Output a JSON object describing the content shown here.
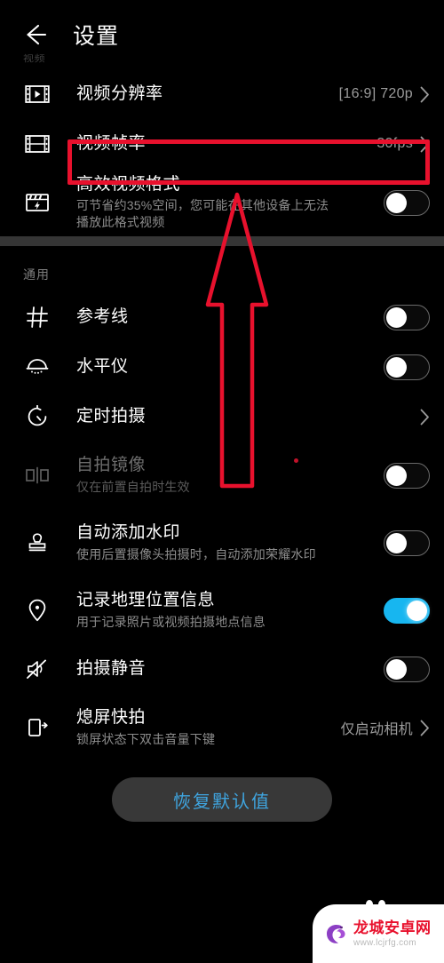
{
  "header": {
    "back_icon": "back-arrow-icon",
    "title": "设置",
    "faint_caption": "视频"
  },
  "video_section": {
    "rows": [
      {
        "icon": "video-resolution-icon",
        "title": "视频分辨率",
        "value": "[16:9] 720p",
        "control": "chevron"
      },
      {
        "icon": "video-framerate-icon",
        "title": "视频帧率",
        "value": "30fps",
        "control": "chevron",
        "highlighted": true
      },
      {
        "icon": "efficient-video-format-icon",
        "title": "高效视频格式",
        "subtitle": "可节省约35%空间，您可能在其他设备上无法播放此格式视频",
        "control": "toggle",
        "toggle_on": false
      }
    ]
  },
  "general_section": {
    "label": "通用",
    "rows": [
      {
        "icon": "grid-lines-icon",
        "title": "参考线",
        "control": "toggle",
        "toggle_on": false
      },
      {
        "icon": "level-meter-icon",
        "title": "水平仪",
        "control": "toggle",
        "toggle_on": false
      },
      {
        "icon": "timer-icon",
        "title": "定时拍摄",
        "control": "chevron"
      },
      {
        "icon": "mirror-selfie-icon",
        "title": "自拍镜像",
        "subtitle": "仅在前置自拍时生效",
        "control": "toggle",
        "toggle_on": false,
        "disabled": true
      },
      {
        "icon": "watermark-stamp-icon",
        "title": "自动添加水印",
        "subtitle": "使用后置摄像头拍摄时，自动添加荣耀水印",
        "control": "toggle",
        "toggle_on": false
      },
      {
        "icon": "location-pin-icon",
        "title": "记录地理位置信息",
        "subtitle": "用于记录照片或视频拍摄地点信息",
        "control": "toggle",
        "toggle_on": true
      },
      {
        "icon": "mute-speaker-icon",
        "title": "拍摄静音",
        "control": "toggle",
        "toggle_on": false
      },
      {
        "icon": "screen-off-capture-icon",
        "title": "熄屏快拍",
        "subtitle": "锁屏状态下双击音量下键",
        "value": "仅启动相机",
        "control": "chevron"
      }
    ]
  },
  "footer": {
    "restore_label": "恢复默认值"
  },
  "annotations": {
    "highlight_target": "视频帧率",
    "arrow": "up-arrow-annotation",
    "colors": {
      "annotation_red": "#e8112d",
      "toggle_on": "#17b6f0",
      "restore_text": "#3fa5e0",
      "band": "#353535"
    }
  },
  "watermark": {
    "title": "龙城安卓网",
    "url": "www.lcjrfg.com",
    "logo": "dragon-logo-icon"
  }
}
